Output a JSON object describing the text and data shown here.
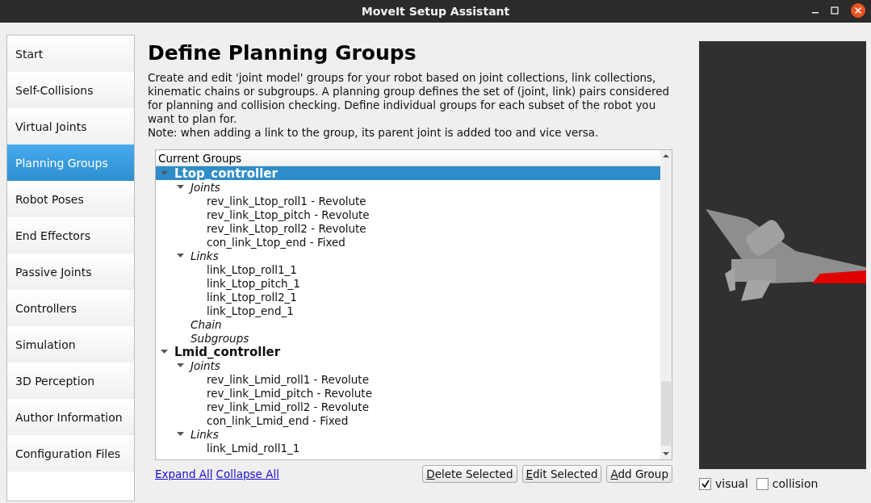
{
  "window": {
    "title": "MoveIt Setup Assistant"
  },
  "sidebar": {
    "items": [
      {
        "label": "Start",
        "selected": false
      },
      {
        "label": "Self-Collisions",
        "selected": false
      },
      {
        "label": "Virtual Joints",
        "selected": false
      },
      {
        "label": "Planning Groups",
        "selected": true
      },
      {
        "label": "Robot Poses",
        "selected": false
      },
      {
        "label": "End Effectors",
        "selected": false
      },
      {
        "label": "Passive Joints",
        "selected": false
      },
      {
        "label": "Controllers",
        "selected": false
      },
      {
        "label": "Simulation",
        "selected": false
      },
      {
        "label": "3D Perception",
        "selected": false
      },
      {
        "label": "Author Information",
        "selected": false
      },
      {
        "label": "Configuration Files",
        "selected": false
      }
    ]
  },
  "page": {
    "title": "Define Planning Groups",
    "description": "Create and edit 'joint model' groups for your robot based on joint collections, link collections, kinematic chains or subgroups. A planning group defines the set of (joint, link) pairs considered for planning and collision checking. Define individual groups for each subset of the robot you want to plan for.",
    "note": "Note: when adding a link to the group, its parent joint is added too and vice versa."
  },
  "tree": {
    "header": "Current Groups",
    "items": [
      {
        "kind": "group",
        "label": "Ltop_controller",
        "selected": true,
        "expanded": true,
        "children": [
          {
            "kind": "category",
            "label": "Joints",
            "expanded": true,
            "children": [
              {
                "kind": "item",
                "label": "rev_link_Ltop_roll1 - Revolute"
              },
              {
                "kind": "item",
                "label": "rev_link_Ltop_pitch - Revolute"
              },
              {
                "kind": "item",
                "label": "rev_link_Ltop_roll2 - Revolute"
              },
              {
                "kind": "item",
                "label": "con_link_Ltop_end - Fixed"
              }
            ]
          },
          {
            "kind": "category",
            "label": "Links",
            "expanded": true,
            "children": [
              {
                "kind": "item",
                "label": "link_Ltop_roll1_1"
              },
              {
                "kind": "item",
                "label": "link_Ltop_pitch_1"
              },
              {
                "kind": "item",
                "label": "link_Ltop_roll2_1"
              },
              {
                "kind": "item",
                "label": "link_Ltop_end_1"
              }
            ]
          },
          {
            "kind": "category",
            "label": "Chain"
          },
          {
            "kind": "category",
            "label": "Subgroups"
          }
        ]
      },
      {
        "kind": "group",
        "label": "Lmid_controller",
        "selected": false,
        "expanded": true,
        "children": [
          {
            "kind": "category",
            "label": "Joints",
            "expanded": true,
            "children": [
              {
                "kind": "item",
                "label": "rev_link_Lmid_roll1 - Revolute"
              },
              {
                "kind": "item",
                "label": "rev_link_Lmid_pitch - Revolute"
              },
              {
                "kind": "item",
                "label": "rev_link_Lmid_roll2 - Revolute"
              },
              {
                "kind": "item",
                "label": "con_link_Lmid_end - Fixed"
              }
            ]
          },
          {
            "kind": "category",
            "label": "Links",
            "expanded": true,
            "children": [
              {
                "kind": "item",
                "label": "link_Lmid_roll1_1"
              }
            ]
          }
        ]
      }
    ]
  },
  "links": [
    "Expand All",
    "Collapse All"
  ],
  "buttons": [
    "Delete Selected",
    "Edit Selected",
    "Add Group"
  ],
  "viewer": {
    "options": [
      {
        "label": "visual",
        "checked": true
      },
      {
        "label": "collision",
        "checked": false
      }
    ]
  }
}
